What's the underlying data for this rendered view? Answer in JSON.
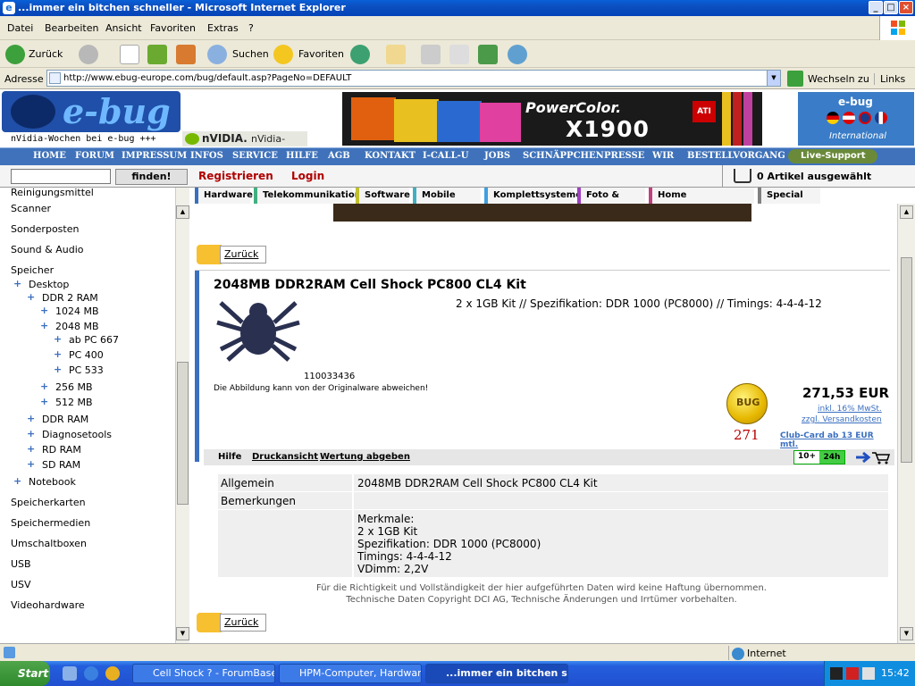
{
  "window": {
    "title": "...immer ein bitchen schneller - Microsoft Internet Explorer"
  },
  "menu": [
    "Datei",
    "Bearbeiten",
    "Ansicht",
    "Favoriten",
    "Extras",
    "?"
  ],
  "toolbar": {
    "back": "Zurück",
    "search": "Suchen",
    "favorites": "Favoriten"
  },
  "address": {
    "label": "Adresse",
    "url": "http://www.ebug-europe.com/bug/default.asp?PageNo=DEFAULT",
    "go": "Wechseln zu",
    "links": "Links"
  },
  "site": {
    "logo": "e-bug",
    "tagline": "nVidia-Wochen bei e-bug +++",
    "nvidia": "nVIDIA.",
    "nvidia_tail": "nVidia-",
    "ad_brand": "PowerColor.",
    "ad_model": "X1900",
    "ad_badge": "ATI",
    "intl_title": "e-bug",
    "intl_sub": "International",
    "nav": [
      "HOME",
      "FORUM",
      "IMPRESSUM",
      "INFOS",
      "SERVICE",
      "HILFE",
      "AGB",
      "KONTAKT",
      "I-CALL-U",
      "JOBS",
      "SCHNÄPPCHEN",
      "PRESSE",
      "WIR",
      "BESTELLVORGANG"
    ],
    "live_support": "Live-Support",
    "find": "finden!",
    "register": "Registrieren",
    "login": "Login",
    "cart": "0 Artikel ausgewählt",
    "categories": [
      "Hardware",
      "Telekommunikation",
      "Software",
      "Mobile World",
      "Komplettsysteme",
      "Foto & Video",
      "Home Entertainment",
      "Special Deal"
    ]
  },
  "sidebar": {
    "items": [
      "Reinigungsmittel",
      "Scanner",
      "Sonderposten",
      "Sound & Audio",
      "Speicher",
      "Desktop",
      "DDR 2 RAM",
      "1024 MB",
      "2048 MB",
      "ab PC 667",
      "PC 400",
      "PC 533",
      "256 MB",
      "512 MB",
      "DDR RAM",
      "Diagnosetools",
      "RD RAM",
      "SD RAM",
      "Notebook",
      "Speicherkarten",
      "Speichermedien",
      "Umschaltboxen",
      "USB",
      "USV",
      "Videohardware"
    ]
  },
  "product": {
    "back": "Zurück",
    "title": "2048MB DDR2RAM Cell Shock PC800 CL4 Kit",
    "subtitle": "2 x 1GB Kit // Spezifikation: DDR 1000 (PC8000) // Timings: 4-4-4-12",
    "article_no": "110033436",
    "disclaimer": "Die Abbildung kann von der Originalware abweichen!",
    "coin_label": "BUG",
    "points": "271",
    "price": "271,53 EUR",
    "vat": "inkl. 16% MwSt.",
    "shipping": "zzgl. Versandkosten",
    "club": "Club-Card ab 13 EUR mtl.",
    "help": "Hilfe",
    "print": "Druckansicht",
    "rate": "Wertung abgeben",
    "stock": "10+",
    "delivery": "24h"
  },
  "spec": {
    "general_label": "Allgemein",
    "general_value": "2048MB DDR2RAM Cell Shock PC800 CL4 Kit",
    "notes_label": "Bemerkungen",
    "features": [
      "Merkmale:",
      "2 x 1GB Kit",
      "Spezifikation: DDR 1000 (PC8000)",
      "Timings: 4-4-4-12",
      "VDimm: 2,2V"
    ],
    "legal1": "Für die Richtigkeit und Vollständigkeit der hier aufgeführten Daten wird keine Haftung übernommen.",
    "legal2": "Technische Daten Copyright DCI AG, Technische Änderungen und Irrtümer vorbehalten."
  },
  "status": {
    "zone": "Internet"
  },
  "taskbar": {
    "start": "Start",
    "tasks": [
      "Cell Shock ? - ForumBase...",
      "HPM-Computer, Hardwar...",
      "...immer ein bitchen s..."
    ],
    "clock": "15:42"
  },
  "colors": {
    "accent": "#3f72ba",
    "price_red": "#b00000",
    "link_blue": "#3a6fc0"
  }
}
